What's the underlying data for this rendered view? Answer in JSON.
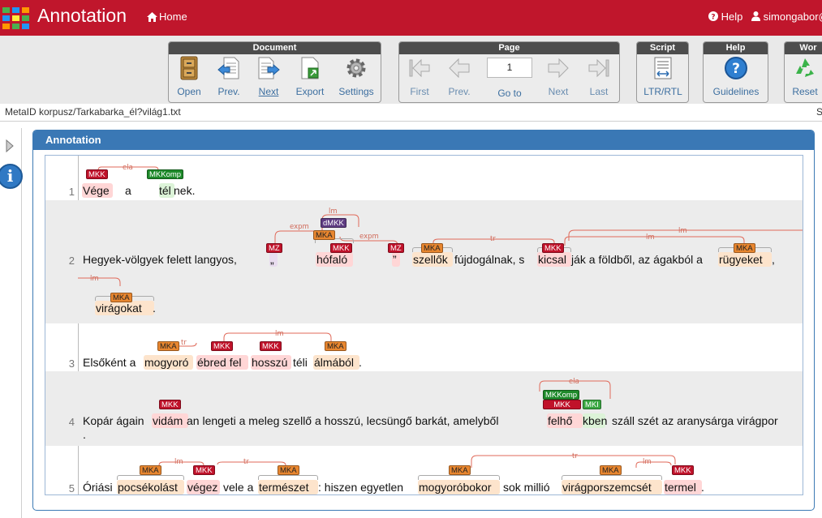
{
  "app": {
    "title": "Annotation",
    "home_label": "Home",
    "help_label": "Help",
    "user_label": "simongabor@"
  },
  "toolbar": {
    "document": {
      "title": "Document",
      "open": "Open",
      "prev": "Prev.",
      "next": "Next",
      "export": "Export",
      "settings": "Settings"
    },
    "page": {
      "title": "Page",
      "first": "First",
      "prev": "Prev.",
      "goto": "Go to",
      "next": "Next",
      "last": "Last",
      "page_value": "1"
    },
    "script": {
      "title": "Script",
      "ltr_rtl": "LTR/RTL"
    },
    "help": {
      "title": "Help",
      "guidelines": "Guidelines"
    },
    "work": {
      "title": "Wor",
      "reset": "Reset"
    }
  },
  "file_path": "MetaID korpusz/Tarkabarka_él?világ1.txt",
  "file_path_right": "S",
  "panel": {
    "title": "Annotation"
  },
  "colors": {
    "accent": "#c0162c",
    "panel": "#3a78b5",
    "MKK": "#c0122a",
    "MKA": "#e8862f",
    "MKKomp": "#1e8a2a",
    "dMKK": "#5e3c82"
  },
  "lines": {
    "l1": {
      "num": "1",
      "t1": "Vége",
      "t2": "a",
      "t3": "tél",
      "t4": "nek."
    },
    "l2": {
      "num": "2",
      "t1": "Hegyek-völgyek felett langyos,",
      "t2": "„",
      "t3": "hófaló",
      "t4": "”",
      "t5": "szellők",
      "t6": "fújdogálnak, s",
      "t7": "kicsal",
      "t8": "ják a földből, az ágakból a",
      "t9": "rügyeket",
      "t10": ",",
      "t11": "virágokat",
      "t12": "."
    },
    "l3": {
      "num": "3",
      "t1": "Elsőként a",
      "t2": "mogyoró",
      "t3": "ébred fel",
      "t4": "hosszú",
      "t5": "téli",
      "t6": "álmából",
      "t7": "."
    },
    "l4": {
      "num": "4",
      "t1": "Kopár ágain",
      "t2": "vidám",
      "t3": "an lengeti a meleg szellő a hosszú, lecsüngő barkát, amelyből",
      "t4": "felhő",
      "t5": "kben",
      "t6": "száll szét az aranysárga virágpor",
      "t7": "."
    },
    "l5": {
      "num": "5",
      "t1": "Óriási",
      "t2": "pocsékolást",
      "t3": "végez",
      "t4": "vele a",
      "t5": "természet",
      "t6": ": hiszen egyetlen",
      "t7": "mogyoróbokor",
      "t8": "sok millió",
      "t9": "virágporszemcsét",
      "t10": "termel",
      "t11": "."
    }
  },
  "labels": {
    "MKK": "MKK",
    "MKA": "MKA",
    "MKKomp": "MKKomp",
    "MKI": "MKI",
    "MZ": "MZ",
    "dMKK": "dMKK"
  },
  "relations": {
    "ela": "ela",
    "lm": "lm",
    "tr": "tr",
    "expm": "expm"
  }
}
